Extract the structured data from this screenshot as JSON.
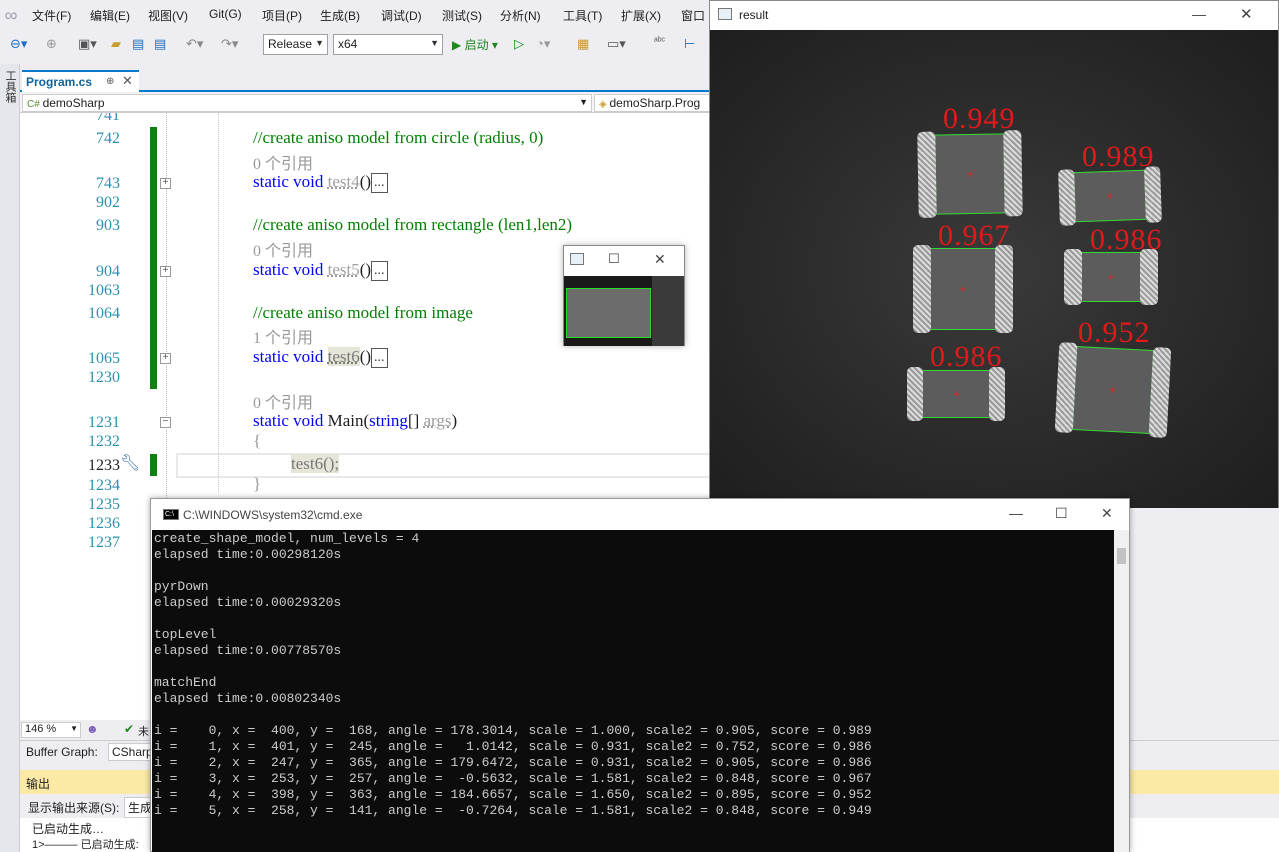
{
  "menu": [
    "文件(F)",
    "编辑(E)",
    "视图(V)",
    "Git(G)",
    "项目(P)",
    "生成(B)",
    "调试(D)",
    "测试(S)",
    "分析(N)",
    "工具(T)",
    "扩展(X)",
    "窗口"
  ],
  "toolbar": {
    "config": "Release",
    "platform": "x64",
    "start": "启动"
  },
  "side_tool": "工具箱",
  "tab": {
    "label": "Program.cs",
    "pin": "⊕",
    "close": "✕"
  },
  "nav": {
    "project": "demoSharp",
    "member": "demoSharp.Prog"
  },
  "editor": {
    "lines": [
      {
        "num": "741"
      },
      {
        "num": "742",
        "comment": "//create aniso model from circle (radius, 0)"
      },
      {
        "refs": "0 个引用"
      },
      {
        "num": "743",
        "kw": "static void",
        "fn": "test4",
        "tail": "()"
      },
      {
        "num": "902"
      },
      {
        "num": "903",
        "comment": "//create aniso model from rectangle (len1,len2)"
      },
      {
        "refs": "0 个引用"
      },
      {
        "num": "904",
        "kw": "static void",
        "fn": "test5",
        "tail": "()"
      },
      {
        "num": "1063"
      },
      {
        "num": "1064",
        "comment": "//create aniso model from image"
      },
      {
        "refs": "1 个引用"
      },
      {
        "num": "1065",
        "kw": "static void",
        "fn": "test6",
        "tail": "()"
      },
      {
        "num": "1230"
      },
      {
        "refs": "0 个引用"
      },
      {
        "num": "1231",
        "kw": "static void",
        "fn": "Main",
        "tail_kw": "string",
        "tail": "[] ",
        "param": "args",
        "close": ")"
      },
      {
        "num": "1232",
        "text": "{"
      },
      {
        "num": "1233",
        "text": "test6();"
      },
      {
        "num": "1234",
        "text": "}"
      },
      {
        "num": "1235"
      },
      {
        "num": "1236"
      },
      {
        "num": "1237"
      }
    ],
    "ellipsis": "..."
  },
  "editor_status": {
    "zoom": "146 %",
    "status": "未"
  },
  "buffer_graph": {
    "label": "Buffer Graph:",
    "value": "CSharp"
  },
  "output": {
    "header": "输出",
    "source_label": "显示输出来源(S):",
    "source_value": "生成",
    "line1": "已启动生成…",
    "line2": "1>——— 已启动生成:"
  },
  "cmd": {
    "title": "C:\\WINDOWS\\system32\\cmd.exe",
    "lines": [
      "create_shape_model, num_levels = 4",
      "elapsed time:0.00298120s",
      "",
      "pyrDown",
      "elapsed time:0.00029320s",
      "",
      "topLevel",
      "elapsed time:0.00778570s",
      "",
      "matchEnd",
      "elapsed time:0.00802340s",
      "",
      "i =    0, x =  400, y =  168, angle = 178.3014, scale = 1.000, scale2 = 0.905, score = 0.989",
      "i =    1, x =  401, y =  245, angle =   1.0142, scale = 0.931, scale2 = 0.752, score = 0.986",
      "i =    2, x =  247, y =  365, angle = 179.6472, scale = 0.931, scale2 = 0.905, score = 0.986",
      "i =    3, x =  253, y =  257, angle =  -0.5632, scale = 1.581, scale2 = 0.848, score = 0.967",
      "i =    4, x =  398, y =  363, angle = 184.6657, scale = 1.650, scale2 = 0.895, score = 0.952",
      "i =    5, x =  258, y =  141, angle =  -0.7264, scale = 1.581, scale2 = 0.848, score = 0.949"
    ]
  },
  "result": {
    "title": "result",
    "scores": [
      "0.949",
      "0.989",
      "0.967",
      "0.986",
      "0.986",
      "0.952"
    ]
  },
  "window_controls": {
    "min": "—",
    "max": "☐",
    "close": "✕"
  }
}
